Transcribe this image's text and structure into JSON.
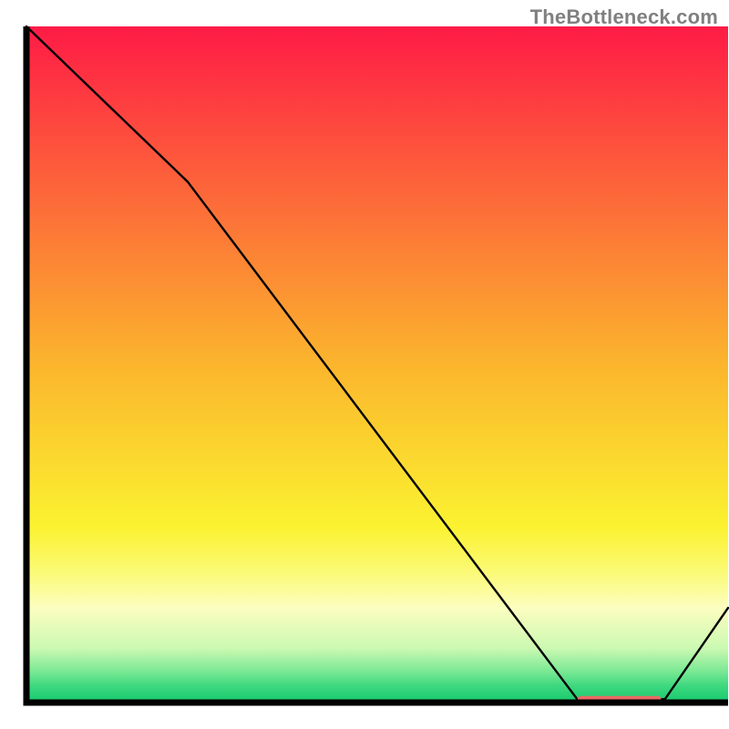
{
  "attribution": "TheBottleneck.com",
  "chart_data": {
    "type": "line",
    "title": "",
    "xlabel": "",
    "ylabel": "",
    "xlim": [
      0,
      100
    ],
    "ylim": [
      0,
      100
    ],
    "x": [
      0,
      23,
      78.5,
      85,
      91,
      100
    ],
    "values": [
      100,
      77,
      0.5,
      0.5,
      0.5,
      14
    ],
    "marker": {
      "x_range": [
        79,
        90
      ],
      "y": 0.5,
      "color": "#ea6a64"
    },
    "background_gradient": {
      "stops": [
        {
          "offset": 0.0,
          "color": "#fe1b46"
        },
        {
          "offset": 0.5,
          "color": "#fbb52d"
        },
        {
          "offset": 0.74,
          "color": "#fbf230"
        },
        {
          "offset": 0.81,
          "color": "#fbfa79"
        },
        {
          "offset": 0.86,
          "color": "#fcfec0"
        },
        {
          "offset": 0.92,
          "color": "#cbf9b2"
        },
        {
          "offset": 0.955,
          "color": "#77e893"
        },
        {
          "offset": 0.975,
          "color": "#3fd87f"
        },
        {
          "offset": 1.0,
          "color": "#16c96d"
        }
      ]
    }
  }
}
